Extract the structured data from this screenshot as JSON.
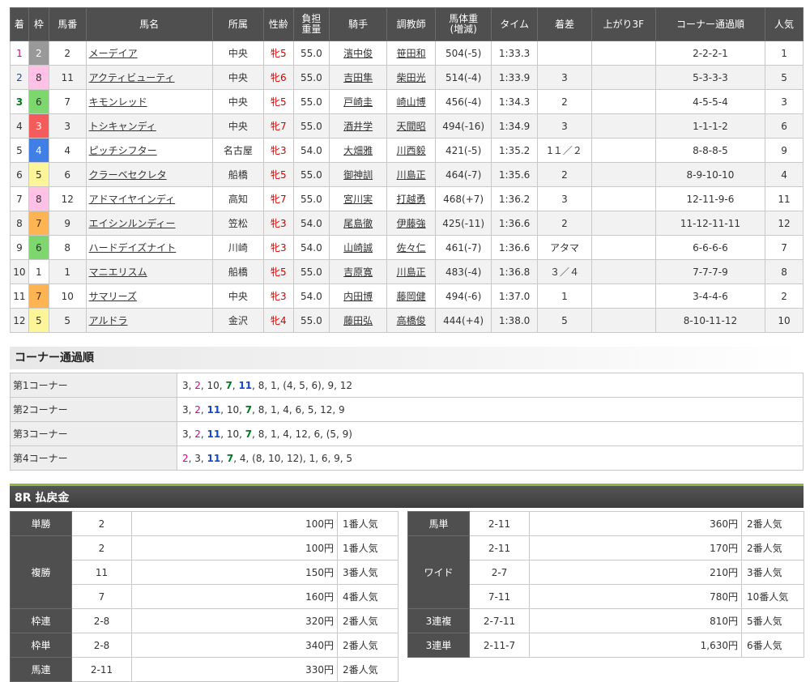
{
  "headers": [
    "着",
    "枠",
    "馬番",
    "馬名",
    "所属",
    "性齢",
    "負担\n重量",
    "騎手",
    "調教師",
    "馬体重\n(増減)",
    "タイム",
    "着差",
    "上がり3F",
    "コーナー通過順",
    "人気"
  ],
  "rows": [
    {
      "pos": "1",
      "waku": "2",
      "num": "2",
      "name": "メーデイア",
      "aff": "中央",
      "sex": "牝5",
      "wt": "55.0",
      "jockey": "濱中俊",
      "trainer": "笹田和",
      "body": "504(-5)",
      "time": "1:33.3",
      "margin": "",
      "last3f": "",
      "corner": "2-2-2-1",
      "pop": "1"
    },
    {
      "pos": "2",
      "waku": "8",
      "num": "11",
      "name": "アクティビューティ",
      "aff": "中央",
      "sex": "牝6",
      "wt": "55.0",
      "jockey": "吉田隼",
      "trainer": "柴田光",
      "body": "514(-4)",
      "time": "1:33.9",
      "margin": "3",
      "last3f": "",
      "corner": "5-3-3-3",
      "pop": "5"
    },
    {
      "pos": "3",
      "waku": "6",
      "num": "7",
      "name": "キモンレッド",
      "aff": "中央",
      "sex": "牝5",
      "wt": "55.0",
      "jockey": "戸崎圭",
      "trainer": "崎山博",
      "body": "456(-4)",
      "time": "1:34.3",
      "margin": "2",
      "last3f": "",
      "corner": "4-5-5-4",
      "pop": "3"
    },
    {
      "pos": "4",
      "waku": "3",
      "num": "3",
      "name": "トシキャンディ",
      "aff": "中央",
      "sex": "牝7",
      "wt": "55.0",
      "jockey": "酒井学",
      "trainer": "天間昭",
      "body": "494(-16)",
      "time": "1:34.9",
      "margin": "3",
      "last3f": "",
      "corner": "1-1-1-2",
      "pop": "6"
    },
    {
      "pos": "5",
      "waku": "4",
      "num": "4",
      "name": "ピッチシフター",
      "aff": "名古屋",
      "sex": "牝3",
      "wt": "54.0",
      "jockey": "大畑雅",
      "trainer": "川西毅",
      "body": "421(-5)",
      "time": "1:35.2",
      "margin": "1１／２",
      "last3f": "",
      "corner": "8-8-8-5",
      "pop": "9"
    },
    {
      "pos": "6",
      "waku": "5",
      "num": "6",
      "name": "クラーベセクレタ",
      "aff": "船橋",
      "sex": "牝5",
      "wt": "55.0",
      "jockey": "御神訓",
      "trainer": "川島正",
      "body": "464(-7)",
      "time": "1:35.6",
      "margin": "2",
      "last3f": "",
      "corner": "8-9-10-10",
      "pop": "4"
    },
    {
      "pos": "7",
      "waku": "8",
      "num": "12",
      "name": "アドマイヤインディ",
      "aff": "高知",
      "sex": "牝7",
      "wt": "55.0",
      "jockey": "宮川実",
      "trainer": "打越勇",
      "body": "468(+7)",
      "time": "1:36.2",
      "margin": "3",
      "last3f": "",
      "corner": "12-11-9-6",
      "pop": "11"
    },
    {
      "pos": "8",
      "waku": "7",
      "num": "9",
      "name": "エイシンルンディー",
      "aff": "笠松",
      "sex": "牝3",
      "wt": "54.0",
      "jockey": "尾島徹",
      "trainer": "伊藤強",
      "body": "425(-11)",
      "time": "1:36.6",
      "margin": "2",
      "last3f": "",
      "corner": "11-12-11-11",
      "pop": "12"
    },
    {
      "pos": "9",
      "waku": "6",
      "num": "8",
      "name": "ハードデイズナイト",
      "aff": "川崎",
      "sex": "牝3",
      "wt": "54.0",
      "jockey": "山崎誠",
      "trainer": "佐々仁",
      "body": "461(-7)",
      "time": "1:36.6",
      "margin": "アタマ",
      "last3f": "",
      "corner": "6-6-6-6",
      "pop": "7"
    },
    {
      "pos": "10",
      "waku": "1",
      "num": "1",
      "name": "マニエリスム",
      "aff": "船橋",
      "sex": "牝5",
      "wt": "55.0",
      "jockey": "吉原寛",
      "trainer": "川島正",
      "body": "483(-4)",
      "time": "1:36.8",
      "margin": "３／４",
      "last3f": "",
      "corner": "7-7-7-9",
      "pop": "8"
    },
    {
      "pos": "11",
      "waku": "7",
      "num": "10",
      "name": "サマリーズ",
      "aff": "中央",
      "sex": "牝3",
      "wt": "54.0",
      "jockey": "内田博",
      "trainer": "藤岡健",
      "body": "494(-6)",
      "time": "1:37.0",
      "margin": "1",
      "last3f": "",
      "corner": "3-4-4-6",
      "pop": "2"
    },
    {
      "pos": "12",
      "waku": "5",
      "num": "5",
      "name": "アルドラ",
      "aff": "金沢",
      "sex": "牝4",
      "wt": "55.0",
      "jockey": "藤田弘",
      "trainer": "高橋俊",
      "body": "444(+4)",
      "time": "1:38.0",
      "margin": "5",
      "last3f": "",
      "corner": "8-10-11-12",
      "pop": "10"
    }
  ],
  "corner_section": {
    "title": "コーナー通過順",
    "rows": [
      {
        "label": "第1コーナー",
        "parts": [
          {
            "t": "3, "
          },
          {
            "t": "2",
            "c": "pink"
          },
          {
            "t": ", 10, "
          },
          {
            "t": "7",
            "c": "green"
          },
          {
            "t": ", "
          },
          {
            "t": "11",
            "c": "blue"
          },
          {
            "t": ", 8, 1, (4, 5, 6), 9, 12"
          }
        ]
      },
      {
        "label": "第2コーナー",
        "parts": [
          {
            "t": "3, "
          },
          {
            "t": "2",
            "c": "pink"
          },
          {
            "t": ", "
          },
          {
            "t": "11",
            "c": "blue"
          },
          {
            "t": ", 10, "
          },
          {
            "t": "7",
            "c": "green"
          },
          {
            "t": ", 8, 1, 4, 6, 5, 12, 9"
          }
        ]
      },
      {
        "label": "第3コーナー",
        "parts": [
          {
            "t": "3, "
          },
          {
            "t": "2",
            "c": "pink"
          },
          {
            "t": ", "
          },
          {
            "t": "11",
            "c": "blue"
          },
          {
            "t": ", 10, "
          },
          {
            "t": "7",
            "c": "green"
          },
          {
            "t": ", 8, 1, 4, 12, 6, (5, 9)"
          }
        ]
      },
      {
        "label": "第4コーナー",
        "parts": [
          {
            "t": "2",
            "c": "pink"
          },
          {
            "t": ", 3, "
          },
          {
            "t": "11",
            "c": "blue"
          },
          {
            "t": ", "
          },
          {
            "t": "7",
            "c": "green"
          },
          {
            "t": ", 4, (8, 10, 12), 1, 6, 9, 5"
          }
        ]
      }
    ]
  },
  "payout_section": {
    "title": "8R 払戻金",
    "left": [
      {
        "kind": "単勝",
        "items": [
          {
            "n": "2",
            "y": "100円",
            "p": "1番人気"
          }
        ]
      },
      {
        "kind": "複勝",
        "items": [
          {
            "n": "2",
            "y": "100円",
            "p": "1番人気"
          },
          {
            "n": "11",
            "y": "150円",
            "p": "3番人気"
          },
          {
            "n": "7",
            "y": "160円",
            "p": "4番人気"
          }
        ]
      },
      {
        "kind": "枠連",
        "items": [
          {
            "n": "2-8",
            "y": "320円",
            "p": "2番人気"
          }
        ]
      },
      {
        "kind": "枠単",
        "items": [
          {
            "n": "2-8",
            "y": "340円",
            "p": "2番人気"
          }
        ]
      },
      {
        "kind": "馬連",
        "items": [
          {
            "n": "2-11",
            "y": "330円",
            "p": "2番人気"
          }
        ]
      }
    ],
    "right": [
      {
        "kind": "馬単",
        "items": [
          {
            "n": "2-11",
            "y": "360円",
            "p": "2番人気"
          }
        ]
      },
      {
        "kind": "ワイド",
        "items": [
          {
            "n": "2-11",
            "y": "170円",
            "p": "2番人気"
          },
          {
            "n": "2-7",
            "y": "210円",
            "p": "3番人気"
          },
          {
            "n": "7-11",
            "y": "780円",
            "p": "10番人気"
          }
        ]
      },
      {
        "kind": "3連複",
        "items": [
          {
            "n": "2-7-11",
            "y": "810円",
            "p": "5番人気"
          }
        ]
      },
      {
        "kind": "3連単",
        "items": [
          {
            "n": "2-11-7",
            "y": "1,630円",
            "p": "6番人気"
          }
        ]
      }
    ]
  },
  "colors": {
    "header_bg": "#4f4f4f",
    "accent_green": "#8fb93a",
    "first": "#e0008a",
    "second": "#1448c8",
    "third": "#007a1f"
  }
}
